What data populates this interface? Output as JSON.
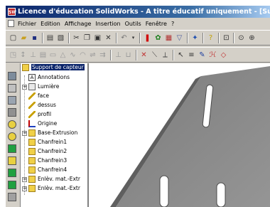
{
  "window": {
    "title": "Licence d'éducation SolidWorks - A titre éducatif uniquement - [Support de capteur]",
    "app_icon": "solidworks-app-icon",
    "title_color": "#0a246a"
  },
  "menu": {
    "items": [
      "Fichier",
      "Edition",
      "Affichage",
      "Insertion",
      "Outils",
      "Fenêtre",
      "?"
    ]
  },
  "tree": {
    "root": "Support de capteur",
    "items": [
      {
        "label": "Annotations",
        "icon": "annotations-icon",
        "expandable": false
      },
      {
        "label": "Lumière",
        "icon": "lighting-icon",
        "expandable": true
      },
      {
        "label": "face",
        "icon": "plane-icon",
        "expandable": false
      },
      {
        "label": "dessus",
        "icon": "plane-icon",
        "expandable": false
      },
      {
        "label": "profil",
        "icon": "plane-icon",
        "expandable": false
      },
      {
        "label": "Origine",
        "icon": "origin-icon",
        "expandable": false
      },
      {
        "label": "Base-Extrusion",
        "icon": "feature-icon",
        "expandable": true
      },
      {
        "label": "Chanfrein1",
        "icon": "feature-icon",
        "expandable": false
      },
      {
        "label": "Chanfrein2",
        "icon": "feature-icon",
        "expandable": false
      },
      {
        "label": "Chanfrein3",
        "icon": "feature-icon",
        "expandable": false
      },
      {
        "label": "Chanfrein4",
        "icon": "feature-icon",
        "expandable": false
      },
      {
        "label": "Enlèv. mat.-Extr",
        "icon": "feature-icon",
        "expandable": true
      },
      {
        "label": "Enlèv. mat.-Extr",
        "icon": "feature-icon",
        "expandable": true
      }
    ]
  },
  "colors": {
    "part_gray": "#8a8a8a",
    "feature_yellow": "#f0d048",
    "selection": "#0a246a"
  }
}
